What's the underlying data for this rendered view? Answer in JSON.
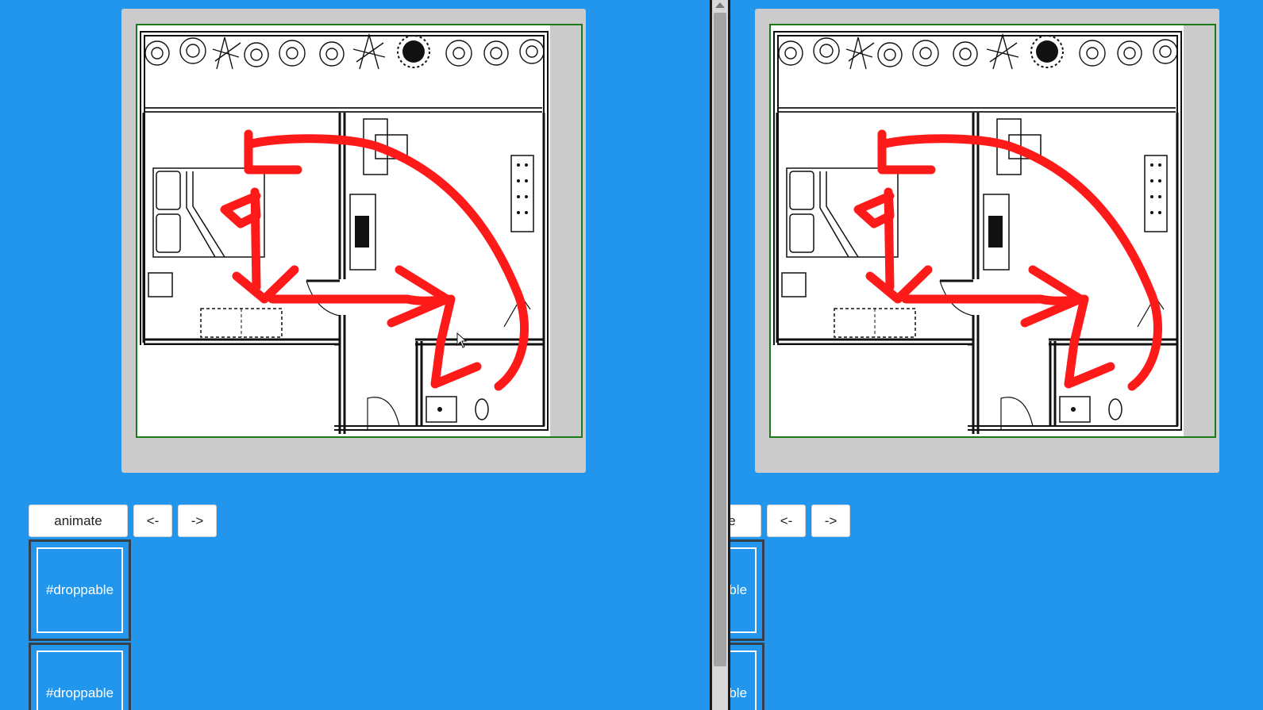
{
  "toolbar": {
    "animate_label": "animate",
    "prev_label": "<-",
    "next_label": "->"
  },
  "droppables": [
    {
      "label": "#droppable"
    },
    {
      "label": "#droppable"
    }
  ],
  "colors": {
    "background": "#2196ec",
    "frame": "#cbcbcb",
    "drop_border": "#1a7a1a",
    "annotation": "#ff0000"
  },
  "icons": {
    "cursor": "mouse-pointer-icon",
    "scroll_up": "scroll-up-arrow-icon"
  }
}
